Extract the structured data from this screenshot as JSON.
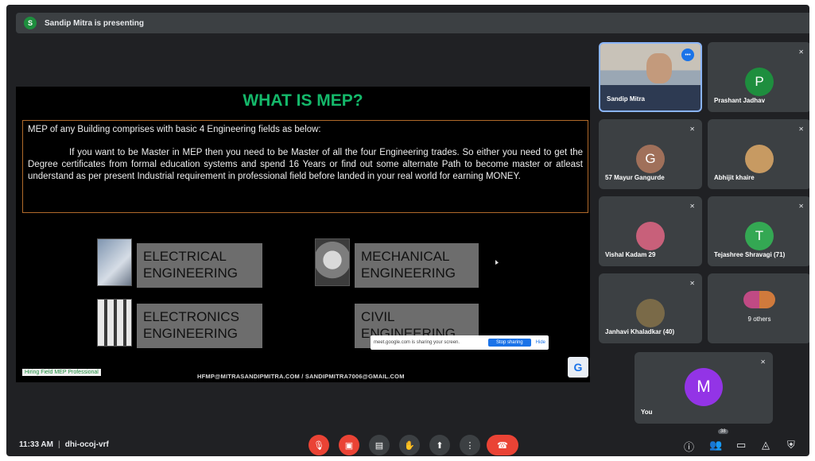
{
  "banner": {
    "avatar": "S",
    "text": "Sandip Mitra is presenting"
  },
  "slide": {
    "title": "WHAT IS MEP?",
    "intro": "MEP of any Building comprises with basic 4 Engineering fields as below:",
    "body": "If you want to be Master in MEP then you need to be Master of all the four Engineering trades. So either you need to get the Degree certificates from formal education systems and spend 16 Years or find out some alternate Path to become master or atleast understand as per present Industrial requirement in professional field before landed in your real world for earning MONEY.",
    "tiles": [
      {
        "line1": "ELECTRICAL",
        "line2": "ENGINEERING"
      },
      {
        "line1": "MECHANICAL",
        "line2": "ENGINEERING"
      },
      {
        "line1": "ELECTRONICS",
        "line2": "ENGINEERING"
      },
      {
        "line1": "CIVIL",
        "line2": "ENGINEERING"
      }
    ],
    "tag": "Hiring Field MEP Professional",
    "email": "HFMP@MITRASANDIPMITRA.COM / SANDIPMITRA7006@GMAIL.COM",
    "logo": "G",
    "share_popup": {
      "message": "meet.google.com is sharing your screen.",
      "stop_label": "Stop sharing",
      "hide_label": "Hide"
    }
  },
  "participants": [
    {
      "name": "Sandip Mitra",
      "kind": "video"
    },
    {
      "name": "Prashant Jadhav",
      "avatar": "P",
      "color": "#1e8e3e"
    },
    {
      "name": "57 Mayur Gangurde",
      "avatar": "G",
      "color": "#a0705a"
    },
    {
      "name": "Abhijit khaire",
      "avatar": "",
      "color": "#c79a62"
    },
    {
      "name": "Vishal Kadam 29",
      "avatar": "",
      "color": "#c8607a"
    },
    {
      "name": "Tejashree Shravagi (71)",
      "avatar": "T",
      "color": "#34a853"
    },
    {
      "name": "Janhavi Khaladkar (40)",
      "avatar": "",
      "color": "#7a6a48"
    },
    {
      "name": "9 others",
      "avatar": ""
    },
    {
      "name": "You",
      "avatar": "M",
      "color": "#9334e6"
    }
  ],
  "bottom": {
    "time": "11:33 AM",
    "meeting_code": "dhi-ocoj-vrf",
    "people_count": "38",
    "icons": [
      "mic-off-icon",
      "camera-off-icon",
      "captions-icon",
      "raise-hand-icon",
      "present-icon",
      "more-icon",
      "end-call-icon",
      "info-icon",
      "people-icon",
      "chat-icon",
      "activities-icon",
      "host-controls-icon"
    ]
  }
}
